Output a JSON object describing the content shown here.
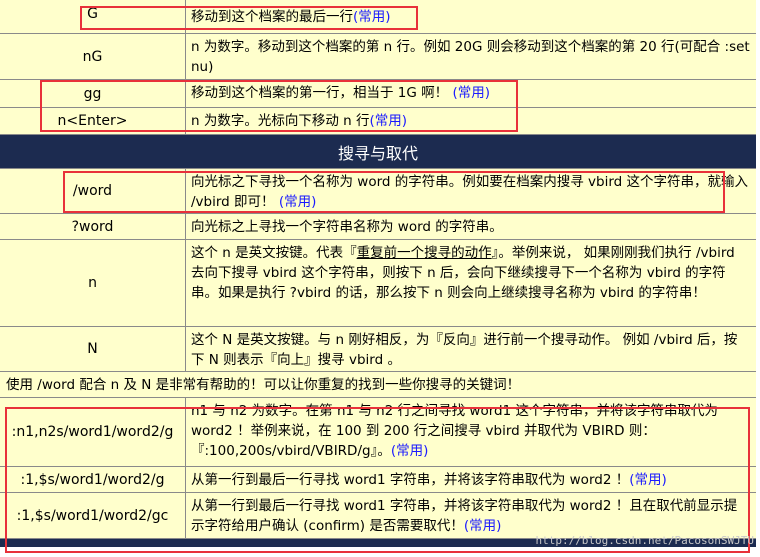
{
  "rows_top": [
    {
      "cmd": "G",
      "desc": "移动到这个档案的最后一行",
      "tag": "(常用)"
    },
    {
      "cmd": "nG",
      "desc": "n 为数字。移动到这个档案的第 n 行。例如 20G 则会移动到这个档案的第 20 行(可配合 :set nu)",
      "tag": ""
    },
    {
      "cmd": "gg",
      "desc": "移动到这个档案的第一行，相当于 1G 啊！",
      "tag": "(常用)"
    },
    {
      "cmd": "n<Enter>",
      "desc": "n 为数字。光标向下移动 n 行",
      "tag": "(常用)"
    }
  ],
  "section_title": "搜寻与取代",
  "rows_search": [
    {
      "cmd": "/word",
      "desc": "向光标之下寻找一个名称为 word 的字符串。例如要在档案内搜寻 vbird 这个字符串，就输入 /vbird 即可！",
      "tag": "(常用)"
    },
    {
      "cmd": "?word",
      "desc": "向光标之上寻找一个字符串名称为 word 的字符串。",
      "tag": ""
    }
  ],
  "row_n": {
    "cmd": "n",
    "pre": "这个 n 是英文按键。代表『",
    "link": "重复前一个搜寻的动作",
    "post": "』。举例来说， 如果刚刚我们执行 /vbird 去向下搜寻 vbird 这个字符串，则按下 n 后，会向下继续搜寻下一个名称为 vbird 的字符串。如果是执行 ?vbird 的话，那么按下 n 则会向上继续搜寻名称为 vbird 的字符串！"
  },
  "row_N": {
    "cmd": "N",
    "desc": "这个 N 是英文按键。与 n 刚好相反，为『反向』进行前一个搜寻动作。 例如 /vbird 后，按下 N 则表示『向上』搜寻 vbird 。"
  },
  "note": "使用 /word 配合 n 及 N 是非常有帮助的！可以让你重复的找到一些你搜寻的关键词！",
  "rows_replace": [
    {
      "cmd": ":n1,n2s/word1/word2/g",
      "desc": "n1 与 n2 为数字。在第 n1 与 n2 行之间寻找 word1 这个字符串，并将该字符串取代为 word2 ！举例来说，在 100 到 200 行之间搜寻 vbird 并取代为 VBIRD 则：『:100,200s/vbird/VBIRD/g』。",
      "tag": "(常用)"
    },
    {
      "cmd": ":1,$s/word1/word2/g",
      "desc": "从第一行到最后一行寻找 word1 字符串，并将该字符串取代为 word2 ！",
      "tag": "(常用)"
    },
    {
      "cmd": ":1,$s/word1/word2/gc",
      "desc": "从第一行到最后一行寻找 word1 字符串，并将该字符串取代为 word2 ！且在取代前显示提示字符给用户确认 (confirm) 是否需要取代！",
      "tag": "(常用)"
    }
  ],
  "watermark": "http://blog.csdn.net/PacosonSWJTU",
  "colors": {
    "cell_bg": "#ffffcc",
    "header_bg": "#1c2b50",
    "highlight": "#e8313a",
    "tag": "#1a1aff"
  }
}
